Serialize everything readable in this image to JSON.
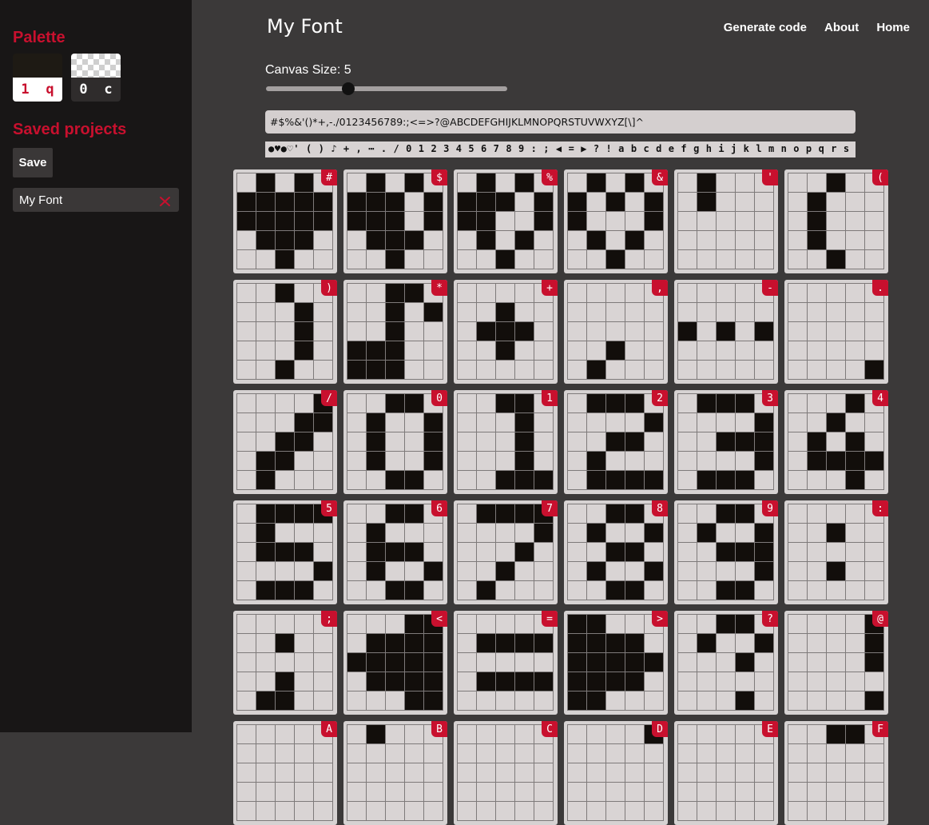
{
  "sidebar": {
    "palette_heading": "Palette",
    "palette": [
      {
        "value": "1",
        "key": "q",
        "color": "#1e1a14"
      },
      {
        "value": "0",
        "key": "c",
        "color": "transparent"
      }
    ],
    "saved_heading": "Saved projects",
    "save_label": "Save",
    "projects": [
      {
        "name": "My Font"
      }
    ]
  },
  "header": {
    "title": "My Font",
    "nav": [
      "Generate code",
      "About",
      "Home"
    ]
  },
  "canvas": {
    "label": "Canvas Size: 5",
    "size": 5,
    "slider_fraction": 0.34
  },
  "characters_input": {
    "value": "#$%&'()*+,-./0123456789:;<=>?@ABCDEFGHIJKLMNOPQRSTUVWXYZ[\\]^"
  },
  "font_preview": "●♥●♡' ( ) ♪ + , ⋯ . / 0 1 2 3 4 5 6 7 8 9 : ; ◀ = ▶ ? ! a b c d e f g h i j k l m n o p q r s t u v w x y z ▷ % ※ ▲",
  "glyphs": [
    {
      "char": "#",
      "rows": [
        "01010",
        "11111",
        "11111",
        "01110",
        "00100"
      ]
    },
    {
      "char": "$",
      "rows": [
        "01010",
        "11101",
        "11101",
        "01110",
        "00100"
      ]
    },
    {
      "char": "%",
      "rows": [
        "01010",
        "11101",
        "11001",
        "01010",
        "00100"
      ]
    },
    {
      "char": "&",
      "rows": [
        "01010",
        "10101",
        "10001",
        "01010",
        "00100"
      ]
    },
    {
      "char": "'",
      "rows": [
        "01000",
        "01000",
        "00000",
        "00000",
        "00000"
      ]
    },
    {
      "char": "(",
      "rows": [
        "00100",
        "01000",
        "01000",
        "01000",
        "00100"
      ]
    },
    {
      "char": ")",
      "rows": [
        "00100",
        "00010",
        "00010",
        "00010",
        "00100"
      ]
    },
    {
      "char": "*",
      "rows": [
        "00110",
        "00101",
        "00100",
        "11100",
        "11100"
      ]
    },
    {
      "char": "+",
      "rows": [
        "00000",
        "00100",
        "01110",
        "00100",
        "00000"
      ]
    },
    {
      "char": ",",
      "rows": [
        "00000",
        "00000",
        "00000",
        "00100",
        "01000"
      ]
    },
    {
      "char": "-",
      "rows": [
        "00000",
        "00000",
        "10101",
        "00000",
        "00000"
      ]
    },
    {
      "char": ".",
      "rows": [
        "00000",
        "00000",
        "00000",
        "00000",
        "00001"
      ]
    },
    {
      "char": "/",
      "rows": [
        "00001",
        "00011",
        "00110",
        "01100",
        "01000"
      ]
    },
    {
      "char": "0",
      "rows": [
        "00110",
        "01001",
        "01001",
        "01001",
        "00110"
      ]
    },
    {
      "char": "1",
      "rows": [
        "00110",
        "00010",
        "00010",
        "00010",
        "00111"
      ]
    },
    {
      "char": "2",
      "rows": [
        "01110",
        "00001",
        "00110",
        "01000",
        "01111"
      ]
    },
    {
      "char": "3",
      "rows": [
        "01110",
        "00001",
        "00111",
        "00001",
        "01110"
      ]
    },
    {
      "char": "4",
      "rows": [
        "00010",
        "00100",
        "01010",
        "01111",
        "00010"
      ]
    },
    {
      "char": "5",
      "rows": [
        "01111",
        "01000",
        "01110",
        "00001",
        "01110"
      ]
    },
    {
      "char": "6",
      "rows": [
        "00110",
        "01000",
        "01110",
        "01001",
        "00110"
      ]
    },
    {
      "char": "7",
      "rows": [
        "01111",
        "00001",
        "00010",
        "00100",
        "01000"
      ]
    },
    {
      "char": "8",
      "rows": [
        "00110",
        "01001",
        "00110",
        "01001",
        "00110"
      ]
    },
    {
      "char": "9",
      "rows": [
        "00110",
        "01001",
        "00111",
        "00001",
        "00110"
      ]
    },
    {
      "char": ":",
      "rows": [
        "00000",
        "00100",
        "00000",
        "00100",
        "00000"
      ]
    },
    {
      "char": ";",
      "rows": [
        "00000",
        "00100",
        "00000",
        "00100",
        "01100"
      ]
    },
    {
      "char": "<",
      "rows": [
        "00011",
        "01111",
        "11111",
        "01111",
        "00011"
      ]
    },
    {
      "char": "=",
      "rows": [
        "00000",
        "01111",
        "00000",
        "01111",
        "00000"
      ]
    },
    {
      "char": ">",
      "rows": [
        "11000",
        "11110",
        "11111",
        "11110",
        "11000"
      ]
    },
    {
      "char": "?",
      "rows": [
        "00110",
        "01001",
        "00010",
        "00000",
        "00010"
      ]
    },
    {
      "char": "@",
      "rows": [
        "00001",
        "00001",
        "00001",
        "00000",
        "00001"
      ]
    },
    {
      "char": "A",
      "rows": [
        "00000"
      ]
    },
    {
      "char": "B",
      "rows": [
        "01000"
      ]
    },
    {
      "char": "C",
      "rows": [
        "00000"
      ]
    },
    {
      "char": "D",
      "rows": [
        "00001"
      ]
    },
    {
      "char": "E",
      "rows": [
        "00000"
      ]
    },
    {
      "char": "F",
      "rows": [
        "00110"
      ]
    }
  ]
}
